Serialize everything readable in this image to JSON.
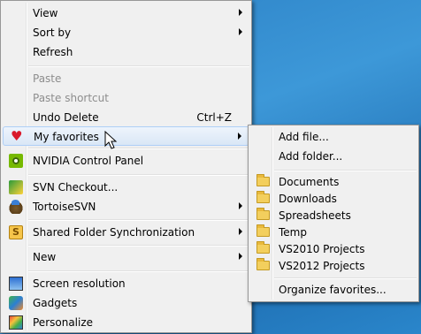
{
  "main_menu": {
    "items": [
      {
        "label": "View",
        "has_submenu": true
      },
      {
        "label": "Sort by",
        "has_submenu": true
      },
      {
        "label": "Refresh"
      },
      {
        "label": "Paste",
        "disabled": true
      },
      {
        "label": "Paste shortcut",
        "disabled": true
      },
      {
        "label": "Undo Delete",
        "shortcut": "Ctrl+Z"
      },
      {
        "label": "My favorites",
        "has_submenu": true,
        "icon": "heart-icon",
        "highlighted": true
      },
      {
        "label": "NVIDIA Control Panel",
        "icon": "nvidia-icon"
      },
      {
        "label": "SVN Checkout...",
        "icon": "svn-checkout-icon"
      },
      {
        "label": "TortoiseSVN",
        "has_submenu": true,
        "icon": "tortoise-icon"
      },
      {
        "label": "Shared Folder Synchronization",
        "has_submenu": true,
        "icon": "sync-icon"
      },
      {
        "label": "New",
        "has_submenu": true
      },
      {
        "label": "Screen resolution",
        "icon": "monitor-icon"
      },
      {
        "label": "Gadgets",
        "icon": "gadgets-icon"
      },
      {
        "label": "Personalize",
        "icon": "personalize-icon"
      }
    ]
  },
  "favorites_submenu": {
    "items": [
      {
        "label": "Add file..."
      },
      {
        "label": "Add folder..."
      },
      {
        "label": "Documents",
        "icon": "folder-icon"
      },
      {
        "label": "Downloads",
        "icon": "folder-icon"
      },
      {
        "label": "Spreadsheets",
        "icon": "folder-icon"
      },
      {
        "label": "Temp",
        "icon": "folder-icon"
      },
      {
        "label": "VS2010 Projects",
        "icon": "folder-icon"
      },
      {
        "label": "VS2012 Projects",
        "icon": "folder-icon"
      },
      {
        "label": "Organize favorites..."
      }
    ]
  },
  "colors": {
    "menu_bg": "#f0f0f0",
    "highlight_border": "#aecff7",
    "disabled_text": "#8d8d8d",
    "heart": "#d9192b",
    "desktop": "#2a7fc4"
  }
}
